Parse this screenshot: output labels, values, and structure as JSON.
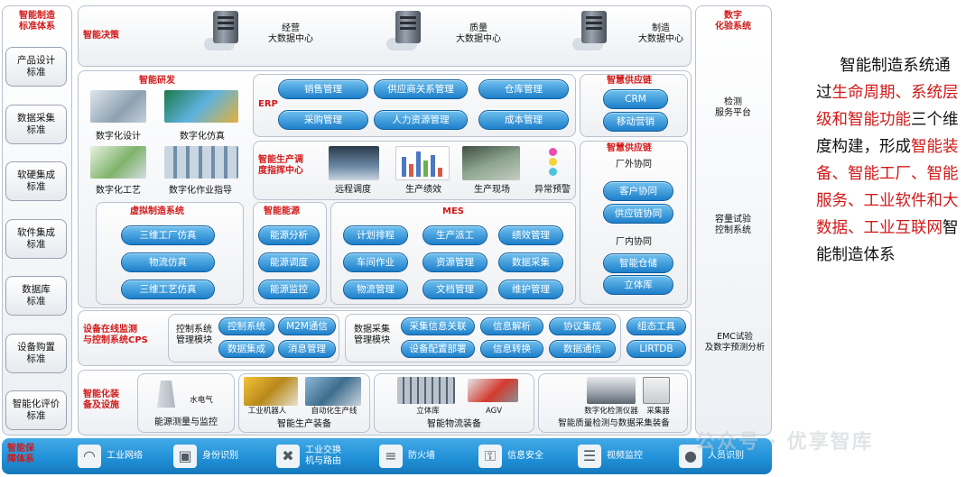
{
  "left_column": {
    "title": "智能制造\n标准体系",
    "items": [
      "产品设计\n标准",
      "数据采集\n标准",
      "软硬集成\n标准",
      "软件集成\n标准",
      "数据库\n标准",
      "设备购置\n标准",
      "智能化评价\n标准"
    ]
  },
  "right_column": {
    "title": "数字\n化验系统",
    "items": [
      "检测\n服务平台",
      "容量试验\n控制系统",
      "EMC试验\n及数字预测分析"
    ]
  },
  "decision": {
    "title": "智能决策",
    "centers": [
      "经营\n大数据中心",
      "质量\n大数据中心",
      "制造\n大数据中心"
    ]
  },
  "rnd": {
    "title": "智能研发",
    "items": [
      "数字化设计",
      "数字化仿真",
      "数字化工艺",
      "数字化作业指导"
    ]
  },
  "virtual": {
    "title": "虚拟制造系统",
    "pills": [
      "三维工厂仿真",
      "物流仿真",
      "三维工艺仿真"
    ]
  },
  "erp": {
    "title": "ERP",
    "pills": [
      "销售管理",
      "供应商关系管理",
      "仓库管理",
      "采购管理",
      "人力资源管理",
      "成本管理"
    ]
  },
  "supply1": {
    "title": "智慧供应链",
    "pills": [
      "CRM",
      "移动营销"
    ]
  },
  "dispatch": {
    "title": "智能生产调\n度指挥中心",
    "items": [
      "远程调度",
      "生产绩效",
      "生产现场",
      "异常预警"
    ]
  },
  "supply2": {
    "title": "智慧供应链",
    "sub1": "厂外协同",
    "pills1": [
      "客户协同",
      "供应链协同"
    ],
    "sub2": "厂内协同",
    "pills2": [
      "智能仓储",
      "立体库"
    ]
  },
  "energy": {
    "title": "智能能源",
    "pills": [
      "能源分析",
      "能源调度",
      "能源监控"
    ]
  },
  "mes": {
    "title": "MES",
    "pills": [
      "计划排程",
      "生产派工",
      "绩效管理",
      "车间作业",
      "资源管理",
      "数据采集",
      "物流管理",
      "文档管理",
      "维护管理"
    ]
  },
  "cps": {
    "title": "设备在线监测\n与控制系统CPS",
    "ctrl_label": "控制系统\n管理模块",
    "ctrl_pills": [
      "控制系统",
      "M2M通信",
      "数据集成",
      "消息管理"
    ],
    "collect_label": "数据采集\n管理模块",
    "collect_pills": [
      "采集信息关联",
      "信息解析",
      "协议集成",
      "设备配置部署",
      "信息转换",
      "数据通信"
    ],
    "tools": [
      "组态工具",
      "LIRTDB"
    ]
  },
  "equipment": {
    "title": "智能化装\n备及设施",
    "groups": [
      {
        "label": "能源测量与监控",
        "captions": [
          "水电气"
        ]
      },
      {
        "label": "智能生产装备",
        "captions": [
          "工业机器人",
          "自动化生产线"
        ]
      },
      {
        "label": "智能物流装备",
        "captions": [
          "立体库",
          "AGV"
        ]
      },
      {
        "label": "智能质量检测与数据采集装备",
        "captions": [
          "数字化检测仪器",
          "采集器"
        ]
      }
    ]
  },
  "bottom": {
    "title": "智能保\n障体系",
    "items": [
      {
        "icon": "wifi-icon",
        "label": "工业网络"
      },
      {
        "icon": "lock-icon",
        "label": "身份识别"
      },
      {
        "icon": "switch-icon",
        "label": "工业交换\n机与路由"
      },
      {
        "icon": "firewall-icon",
        "label": "防火墙"
      },
      {
        "icon": "key-icon",
        "label": "信息安全"
      },
      {
        "icon": "document-icon",
        "label": "视频监控"
      },
      {
        "icon": "person-icon",
        "label": "人员识别"
      }
    ]
  },
  "watermark": "公众号 · 优享智库",
  "side_text": [
    {
      "t": "智能制造系",
      "hl": false
    },
    {
      "t": "统通过",
      "hl": false
    },
    {
      "t": "生命周期、系统层级和智能功能",
      "hl": true
    },
    {
      "t": "三个维度构建，形成",
      "hl": false
    },
    {
      "t": "智能装备、智能工厂、智能服务、工业软件和大数据、工业互联网",
      "hl": true
    },
    {
      "t": "智能制造体系",
      "hl": false
    }
  ],
  "colors": {
    "accent_red": "#d21919",
    "pill_blue": "#1e7fc9",
    "bottom_blue": "#1f8fd6"
  }
}
